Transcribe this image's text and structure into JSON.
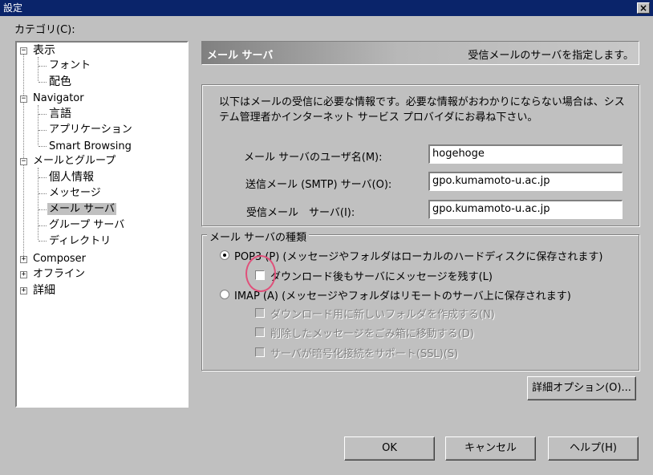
{
  "window": {
    "title": "設定",
    "close_label": "×"
  },
  "category_label": "カテゴリ(C):",
  "tree": [
    {
      "label": "表示",
      "expander": "−"
    },
    {
      "label": "フォント"
    },
    {
      "label": "配色"
    },
    {
      "label": "Navigator",
      "expander": "−"
    },
    {
      "label": "言語"
    },
    {
      "label": "アプリケーション"
    },
    {
      "label": "Smart Browsing"
    },
    {
      "label": "メールとグループ",
      "expander": "−"
    },
    {
      "label": "個人情報"
    },
    {
      "label": "メッセージ"
    },
    {
      "label": "メール サーバ",
      "selected": true
    },
    {
      "label": "グループ サーバ"
    },
    {
      "label": "ディレクトリ"
    },
    {
      "label": "Composer",
      "expander": "+"
    },
    {
      "label": "オフライン",
      "expander": "+"
    },
    {
      "label": "詳細",
      "expander": "+"
    }
  ],
  "header": {
    "title": "メール サーバ",
    "description": "受信メールのサーバを指定します。"
  },
  "info_text": "以下はメールの受信に必要な情報です。必要な情報がおわかりにならない場合は、システム管理者かインターネット サービス プロバイダにお尋ね下さい。",
  "fields": {
    "user_label": "メール サーバのユーザ名(M):",
    "user_value": "hogehoge",
    "smtp_label": "送信メール (SMTP) サーバ(O):",
    "smtp_value": "gpo.kumamoto-u.ac.jp",
    "pop_label": "受信メール　サーバ(I):",
    "pop_value": "gpo.kumamoto-u.ac.jp"
  },
  "server_type": {
    "legend": "メール サーバの種類",
    "pop3_label": "POP3 (P) (メッセージやフォルダはローカルのハードディスクに保存されます)",
    "pop3_leave": "ダウンロード後もサーバにメッセージを残す(L)",
    "imap_label": "IMAP (A) (メッセージやフォルダはリモートのサーバ上に保存されます)",
    "imap_opt1": "ダウンロード用に新しいフォルダを作成する(N)",
    "imap_opt2": "削除したメッセージをごみ箱に移動する(D)",
    "imap_opt3": "サーバが暗号化接続をサポート(SSL)(S)"
  },
  "buttons": {
    "advanced": "詳細オプション(O)...",
    "ok": "OK",
    "cancel": "キャンセル",
    "help": "ヘルプ(H)"
  },
  "colors": {
    "titlebar": "#0a246a",
    "face": "#c0c0c0",
    "highlight_circle": "#e0507a"
  }
}
